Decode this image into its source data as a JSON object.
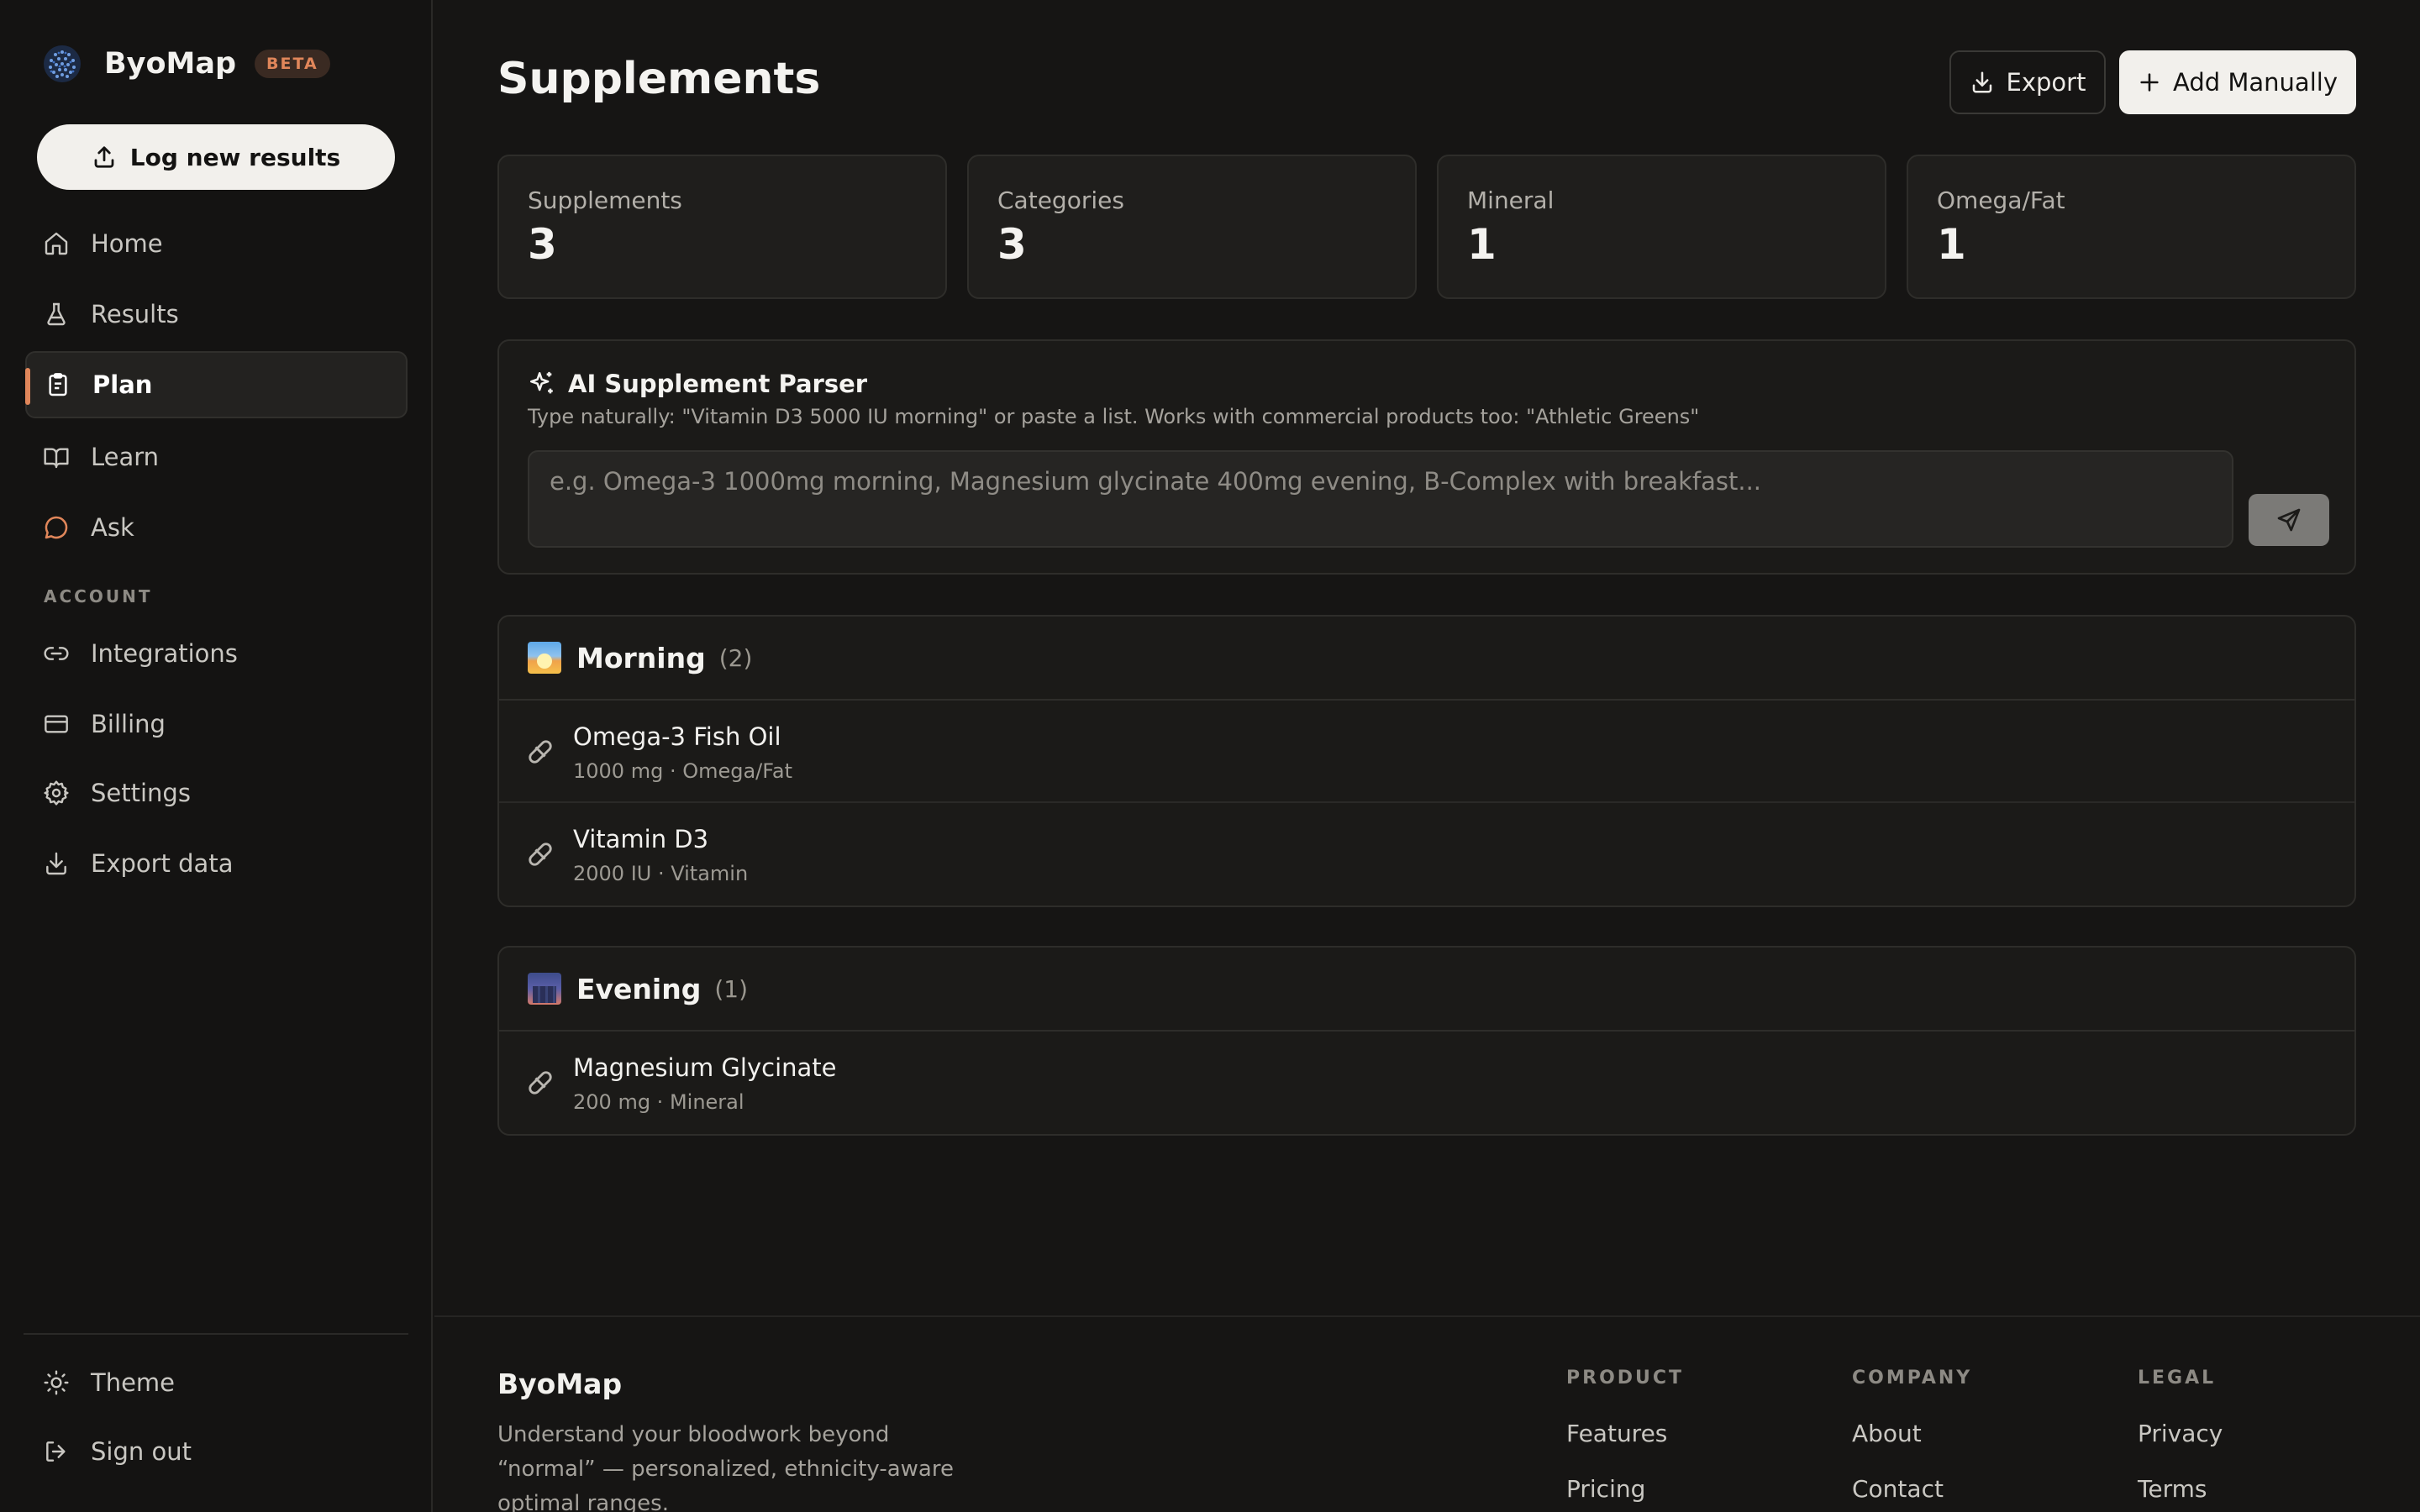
{
  "brand": {
    "name": "ByoMap",
    "badge": "BETA"
  },
  "sidebar": {
    "log_button": "Log new results",
    "items": [
      {
        "label": "Home",
        "icon": "home-icon"
      },
      {
        "label": "Results",
        "icon": "flask-icon"
      },
      {
        "label": "Plan",
        "icon": "clipboard-icon",
        "active": true
      },
      {
        "label": "Learn",
        "icon": "book-icon"
      },
      {
        "label": "Ask",
        "icon": "chat-bubble-icon"
      }
    ],
    "account_label": "ACCOUNT",
    "account_items": [
      {
        "label": "Integrations",
        "icon": "link-icon"
      },
      {
        "label": "Billing",
        "icon": "credit-card-icon"
      },
      {
        "label": "Settings",
        "icon": "gear-icon"
      },
      {
        "label": "Export data",
        "icon": "download-icon"
      }
    ],
    "bottom_items": [
      {
        "label": "Theme",
        "icon": "sun-icon"
      },
      {
        "label": "Sign out",
        "icon": "sign-out-icon"
      }
    ]
  },
  "header": {
    "title": "Supplements",
    "export_label": "Export",
    "add_label": "Add Manually"
  },
  "stats": [
    {
      "label": "Supplements",
      "value": "3"
    },
    {
      "label": "Categories",
      "value": "3"
    },
    {
      "label": "Mineral",
      "value": "1"
    },
    {
      "label": "Omega/Fat",
      "value": "1"
    }
  ],
  "parser": {
    "title": "AI Supplement Parser",
    "subtitle": "Type naturally: \"Vitamin D3 5000 IU morning\" or paste a list. Works with commercial products too: \"Athletic Greens\"",
    "placeholder": "e.g. Omega-3 1000mg morning, Magnesium glycinate 400mg evening, B-Complex with breakfast..."
  },
  "groups": [
    {
      "name": "Morning",
      "count": "(2)",
      "items": [
        {
          "name": "Omega-3 Fish Oil",
          "meta": "1000 mg · Omega/Fat"
        },
        {
          "name": "Vitamin D3",
          "meta": "2000 IU · Vitamin"
        }
      ]
    },
    {
      "name": "Evening",
      "count": "(1)",
      "items": [
        {
          "name": "Magnesium Glycinate",
          "meta": "200 mg · Mineral"
        }
      ]
    }
  ],
  "footer": {
    "brand": "ByoMap",
    "description": "Understand your bloodwork beyond “normal” — personalized, ethnicity-aware optimal ranges.",
    "columns": [
      {
        "title": "PRODUCT",
        "links": [
          "Features",
          "Pricing"
        ]
      },
      {
        "title": "COMPANY",
        "links": [
          "About",
          "Contact"
        ]
      },
      {
        "title": "LEGAL",
        "links": [
          "Privacy",
          "Terms"
        ]
      }
    ]
  },
  "colors": {
    "accent": "#e0865a",
    "background": "#161514",
    "card": "#1f1e1c"
  }
}
